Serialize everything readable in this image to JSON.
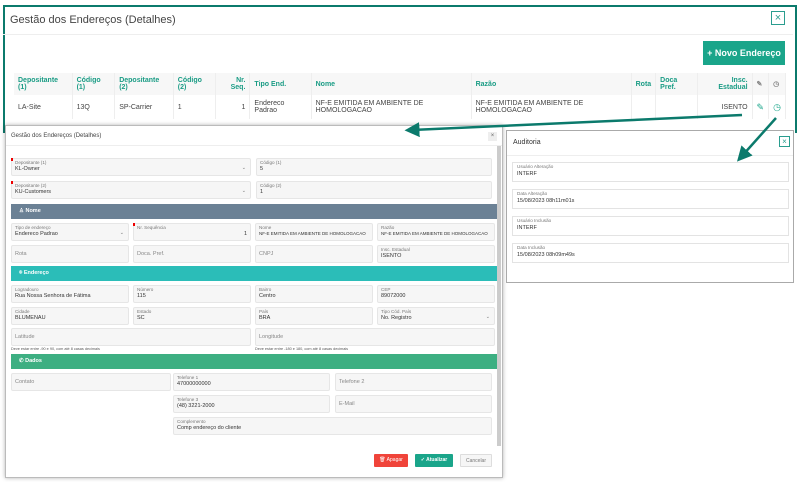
{
  "outer": {
    "title": "Gestão dos Endereços (Detalhes)",
    "close": "×",
    "new_button": "+ Novo Endereço",
    "columns": [
      "Depositante (1)",
      "Código (1)",
      "Depositante (2)",
      "Código (2)",
      "Nr. Seq.",
      "Tipo End.",
      "Nome",
      "Razão",
      "Rota",
      "Doca Pref.",
      "Insc. Estadual"
    ],
    "row": [
      "LA-Site",
      "13Q",
      "SP-Carrier",
      "1",
      "1",
      "Endereco Padrao",
      "NF-E EMITIDA EM AMBIENTE DE HOMOLOGACAO",
      "NF-E EMITIDA EM AMBIENTE DE HOMOLOGACAO",
      "",
      "",
      "ISENTO"
    ]
  },
  "inner": {
    "title": "Gestão dos Endereços (Detalhes)",
    "close": "×",
    "dep1": {
      "label": "Depositante (1)",
      "value": "KL-Owner"
    },
    "cod1": {
      "label": "Código (1)",
      "value": "5"
    },
    "dep2": {
      "label": "Depositante (2)",
      "value": "KU-Customers"
    },
    "cod2": {
      "label": "Código (2)",
      "value": "1"
    },
    "sec_nome": "Nome",
    "tipo": {
      "label": "Tipo de endereço",
      "value": "Endereco Padrao"
    },
    "seq": {
      "label": "Nr. Sequência",
      "value": "1"
    },
    "nome": {
      "label": "Nome",
      "value": "NF-E EMITIDA EM AMBIENTE DE HOMOLOGACAO"
    },
    "razao": {
      "label": "Razão",
      "value": "NF-E EMITIDA EM AMBIENTE DE HOMOLOGACAO"
    },
    "rota": "Rota",
    "doca": "Doca. Pref.",
    "cnpj": "CNPJ",
    "insc": {
      "label": "Insc. Estadual",
      "value": "ISENTO"
    },
    "sec_end": "Endereço",
    "logr": {
      "label": "Logradouro",
      "value": "Rua Nossa Senhora de Fátima"
    },
    "num": {
      "label": "Número",
      "value": "115"
    },
    "bairro": {
      "label": "Bairro",
      "value": "Centro"
    },
    "cep": {
      "label": "CEP",
      "value": "89072000"
    },
    "cidade": {
      "label": "Cidade",
      "value": "BLUMENAU"
    },
    "estado": {
      "label": "Estado",
      "value": "SC"
    },
    "pais": {
      "label": "País",
      "value": "BRA"
    },
    "tipocod": {
      "label": "Tipo Cód. País",
      "value": "No. Registro"
    },
    "lat": "Latitude",
    "lon": "Longitude",
    "lat_hint": "Deve estar entre -90 e 90, com até 8 casas decimais",
    "lon_hint": "Deve estar entre -180 e 180, com até 8 casas decimais",
    "sec_dados": "Dados",
    "contato": "Contato",
    "tel1": {
      "label": "Telefone 1",
      "value": "47000000000"
    },
    "tel2": "Telefone 2",
    "tel3": {
      "label": "Telefone 3",
      "value": "(48) 3221-2000"
    },
    "email": "E-Mail",
    "compl": {
      "label": "Complemento",
      "value": "Comp endereço do cliente"
    },
    "apagar": "Apagar",
    "atualizar": "✓ Atualizar",
    "cancelar": "Cancelar"
  },
  "auditoria": {
    "title": "Auditoria",
    "close": "×",
    "fields": [
      {
        "label": "Usuário Alteração",
        "value": "INTERF"
      },
      {
        "label": "Data Alteração",
        "value": "15/08/2023 08h11m01s"
      },
      {
        "label": "Usuário Inclusão",
        "value": "INTERF"
      },
      {
        "label": "Data Inclusão",
        "value": "15/08/2023 08h09m49s"
      }
    ]
  },
  "colors": {
    "teal": "#1aa58a",
    "slate": "#6b8195",
    "cyan": "#2bbdb8",
    "green": "#3daf82",
    "red": "#f0443a"
  }
}
